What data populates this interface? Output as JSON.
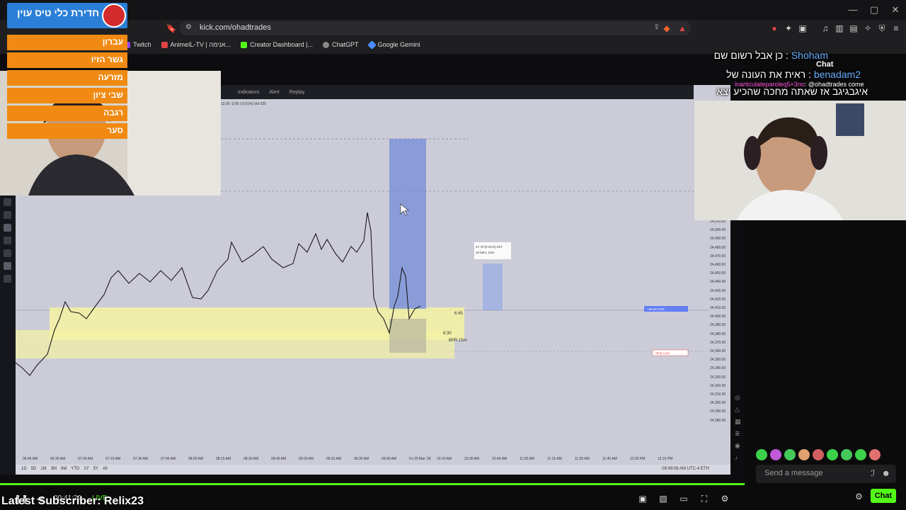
{
  "browser": {
    "url": "kick.com/ohadtrades",
    "bookmarks": [
      "Twitch",
      "AnimeIL-TV | אנימה...",
      "Creator Dashboard |...",
      "ChatGPT",
      "Google Gemini"
    ],
    "bookmark_colors": [
      "#9146ff",
      "#e04444",
      "#53fc18",
      "#888888",
      "#4a8cff"
    ]
  },
  "news": {
    "title": "חדירת כלי טיס עוין",
    "items": [
      "עברון",
      "גשר הזיו",
      "מזרעה",
      "שבי ציון",
      "רגבה",
      "סער"
    ]
  },
  "chat_overlay": {
    "lines": [
      {
        "name": "Shoham",
        "text": "כן אבל רשום שם :"
      },
      {
        "name": "benadam2",
        "text": "ראית את העונה של :"
      },
      {
        "name": "",
        "text": "איגבגיגב אז שאתה מחכה שהכיע יצא"
      }
    ],
    "chat_label": "Chat",
    "mention_user": "inarticulateparoleq5×3no",
    "mention_text": ": @ohadtrades come"
  },
  "chart": {
    "toolbar": [
      "Indicators",
      "Alert",
      "Replay"
    ],
    "ohlc": "12.00 -3.00 (-0.01%) Vol 025",
    "price_ticks": [
      "24,510.00",
      "24,500.00",
      "24,490.00",
      "24,480.00",
      "24,470.00",
      "24,460.00",
      "24,450.00",
      "24,440.00",
      "24,430.00",
      "24,420.00",
      "24,410.00",
      "24,400.00",
      "24,390.00",
      "24,380.00",
      "24,370.00",
      "24,360.00",
      "24,350.00",
      "24,340.00",
      "24,330.00",
      "24,320.00",
      "24,310.00",
      "24,300.00",
      "24,290.00",
      "24,280.00"
    ],
    "time_ticks": [
      "06:45 AM",
      "06:30 AM",
      "07:00 AM",
      "07:15 AM",
      "07:30 AM",
      "07:45 AM",
      "08:00 AM",
      "08:15 AM",
      "08:30 AM",
      "08:45 AM",
      "09:00 AM",
      "09:15 AM",
      "09:30 AM",
      "09:45 AM",
      "Fri 20 Mar '26",
      "10:10 AM",
      "10:30 AM",
      "10:45 AM",
      "11:00 AM",
      "11:15 AM",
      "11:30 AM",
      "11:45 AM",
      "12:00 PM",
      "12:15 PM"
    ],
    "zone_labels": [
      "6:45",
      "6:30",
      "BPR 15m"
    ],
    "tooltip": [
      "47.75 (0.21%) 2ST",
      "10 bars, 10m"
    ],
    "order_labels": [
      "+45.50 USD",
      "Stop Loss"
    ],
    "timeframes": [
      "1D",
      "5D",
      "1M",
      "3M",
      "6M",
      "YTD",
      "1Y",
      "5Y",
      "All"
    ],
    "clock": "09:49:08 AM UTC-4   ETH"
  },
  "player": {
    "latest_subscriber": "Latest Subscriber: Relix23",
    "live_time": "00:41:29",
    "live_label": "LIVE"
  },
  "kick_chat": {
    "placeholder": "Send a message",
    "chat_button": "Chat",
    "emote_colors": [
      "#3cd14a",
      "#c05ad6",
      "#45c75a",
      "#e0a070",
      "#d06060",
      "#3cd14a",
      "#45c75a",
      "#3cd14a",
      "#e07070"
    ]
  },
  "colors": {
    "accent": "#53fc18",
    "news_orange": "#f08a12",
    "news_blue": "#2b7fd6",
    "chart_bg": "#ccccd8"
  }
}
